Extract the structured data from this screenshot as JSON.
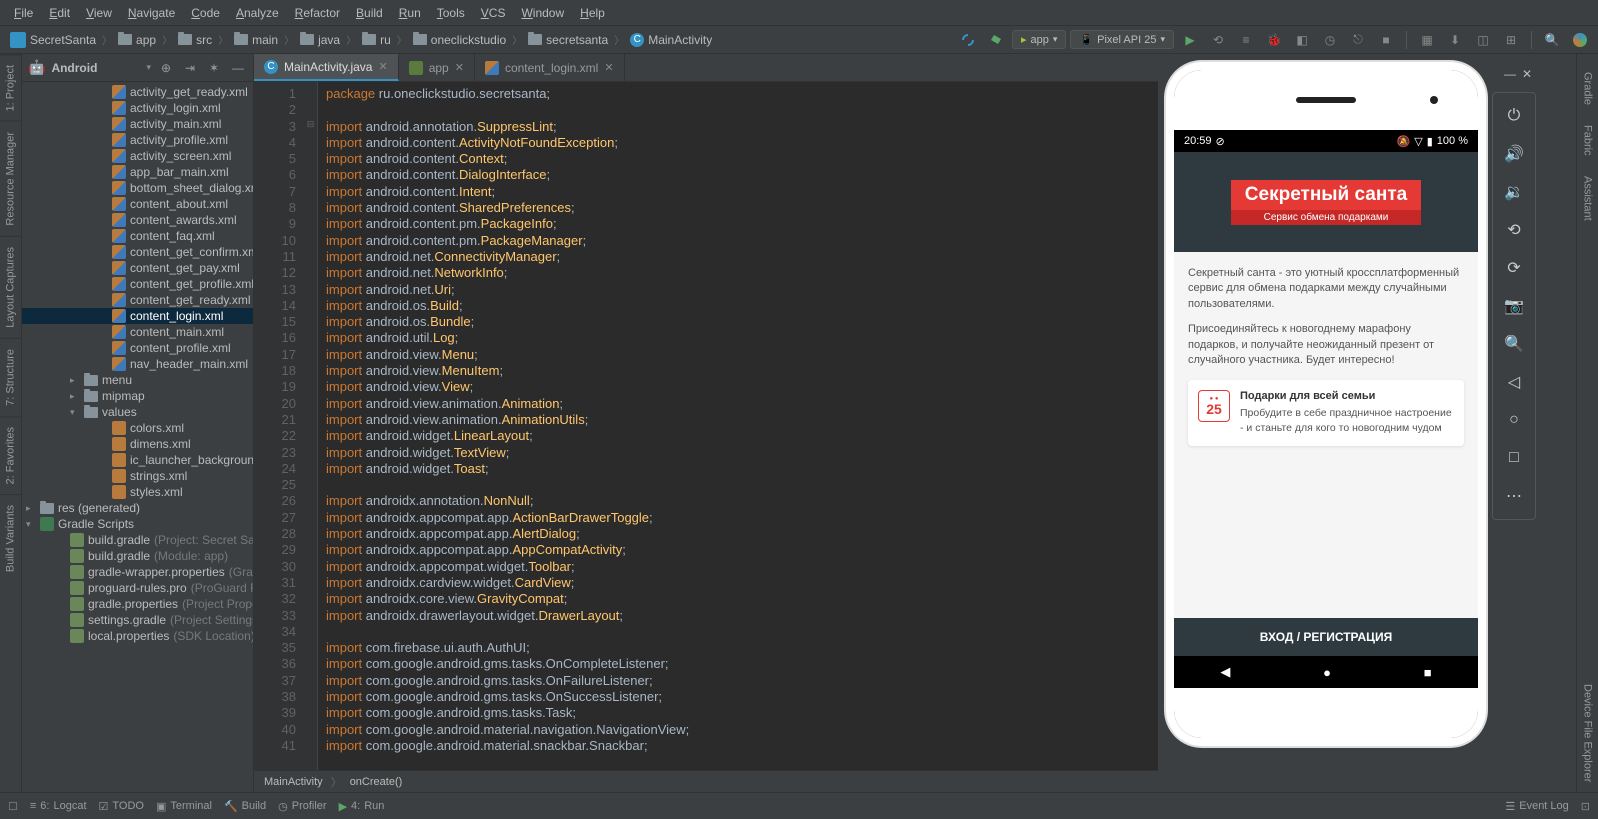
{
  "menubar": [
    "File",
    "Edit",
    "View",
    "Navigate",
    "Code",
    "Analyze",
    "Refactor",
    "Build",
    "Run",
    "Tools",
    "VCS",
    "Window",
    "Help"
  ],
  "breadcrumb": {
    "project": "SecretSanta",
    "items": [
      "app",
      "src",
      "main",
      "java",
      "ru",
      "oneclickstudio",
      "secretsanta"
    ],
    "activity": "MainActivity"
  },
  "runConfig": {
    "app": "app",
    "device": "Pixel API 25"
  },
  "projectPanel": {
    "title": "Android"
  },
  "tree": {
    "layouts": [
      "activity_get_ready.xml",
      "activity_login.xml",
      "activity_main.xml",
      "activity_profile.xml",
      "activity_screen.xml",
      "app_bar_main.xml",
      "bottom_sheet_dialog.xml",
      "content_about.xml",
      "content_awards.xml",
      "content_faq.xml",
      "content_get_confirm.xml",
      "content_get_pay.xml",
      "content_get_profile.xml",
      "content_get_ready.xml",
      "content_login.xml",
      "content_main.xml",
      "content_profile.xml",
      "nav_header_main.xml"
    ],
    "folders": {
      "menu": "menu",
      "mipmap": "mipmap",
      "values": "values",
      "res": "res (generated)",
      "gradle": "Gradle Scripts"
    },
    "values": [
      "colors.xml",
      "dimens.xml",
      "ic_launcher_background.xml",
      "strings.xml",
      "styles.xml"
    ],
    "gradle": [
      {
        "name": "build.gradle",
        "hint": "(Project: Secret Santa)"
      },
      {
        "name": "build.gradle",
        "hint": "(Module: app)"
      },
      {
        "name": "gradle-wrapper.properties",
        "hint": "(Gradle V"
      },
      {
        "name": "proguard-rules.pro",
        "hint": "(ProGuard Rules"
      },
      {
        "name": "gradle.properties",
        "hint": "(Project Properties"
      },
      {
        "name": "settings.gradle",
        "hint": "(Project Settings)"
      },
      {
        "name": "local.properties",
        "hint": "(SDK Location)"
      }
    ]
  },
  "tabs": [
    {
      "icon": "c",
      "label": "MainActivity.java",
      "active": true
    },
    {
      "icon": "mod",
      "label": "app",
      "active": false
    },
    {
      "icon": "xml",
      "label": "content_login.xml",
      "active": false
    }
  ],
  "code": {
    "pkg": "package ru.oneclickstudio.secretsanta;",
    "imports": [
      [
        "android.annotation.",
        "SuppressLint"
      ],
      [
        "android.content.",
        "ActivityNotFoundException"
      ],
      [
        "android.content.",
        "Context"
      ],
      [
        "android.content.",
        "DialogInterface"
      ],
      [
        "android.content.",
        "Intent"
      ],
      [
        "android.content.",
        "SharedPreferences"
      ],
      [
        "android.content.pm.",
        "PackageInfo"
      ],
      [
        "android.content.pm.",
        "PackageManager"
      ],
      [
        "android.net.",
        "ConnectivityManager"
      ],
      [
        "android.net.",
        "NetworkInfo"
      ],
      [
        "android.net.",
        "Uri"
      ],
      [
        "android.os.",
        "Build"
      ],
      [
        "android.os.",
        "Bundle"
      ],
      [
        "android.util.",
        "Log"
      ],
      [
        "android.view.",
        "Menu"
      ],
      [
        "android.view.",
        "MenuItem"
      ],
      [
        "android.view.",
        "View"
      ],
      [
        "android.view.animation.",
        "Animation"
      ],
      [
        "android.view.animation.",
        "AnimationUtils"
      ],
      [
        "android.widget.",
        "LinearLayout"
      ],
      [
        "android.widget.",
        "TextView"
      ],
      [
        "android.widget.",
        "Toast"
      ]
    ],
    "androidx": [
      [
        "androidx.annotation.",
        "NonNull"
      ],
      [
        "androidx.appcompat.app.",
        "ActionBarDrawerToggle"
      ],
      [
        "androidx.appcompat.app.",
        "AlertDialog"
      ],
      [
        "androidx.appcompat.app.",
        "AppCompatActivity"
      ],
      [
        "androidx.appcompat.widget.",
        "Toolbar"
      ],
      [
        "androidx.cardview.widget.",
        "CardView"
      ],
      [
        "androidx.core.view.",
        "GravityCompat"
      ],
      [
        "androidx.drawerlayout.widget.",
        "DrawerLayout"
      ]
    ],
    "google": [
      "com.firebase.ui.auth.AuthUI",
      "com.google.android.gms.tasks.OnCompleteListener",
      "com.google.android.gms.tasks.OnFailureListener",
      "com.google.android.gms.tasks.OnSuccessListener",
      "com.google.android.gms.tasks.Task",
      "com.google.android.material.navigation.NavigationView",
      "com.google.android.material.snackbar.Snackbar"
    ]
  },
  "editorFooter": {
    "class": "MainActivity",
    "method": "onCreate()"
  },
  "emulator": {
    "status": {
      "time": "20:59",
      "battery": "100 %"
    },
    "app": {
      "title": "Секретный санта",
      "subtitle": "Сервис обмена подарками",
      "p1": "Секретный санта - это уютный кроссплатформенный сервис для обмена подарками между случайными пользователями.",
      "p2": "Присоединяйтесь к новогоднему марафону подарков, и получайте неожиданный презент от случайного участника. Будет интересно!",
      "card": {
        "day": "25",
        "title": "Подарки для всей семьи",
        "text": "Пробудите в себе праздничное настроение - и станьте для кого то новогодним чудом"
      },
      "login": "ВХОД / РЕГИСТРАЦИЯ"
    }
  },
  "bottom": {
    "items": [
      "Logcat",
      "TODO",
      "Terminal",
      "Build",
      "Profiler",
      "Run"
    ],
    "prefixes": [
      "6:",
      "",
      "",
      "",
      "",
      "4:"
    ],
    "eventLog": "Event Log"
  },
  "leftTools": [
    "1: Project",
    "Resource Manager",
    "Layout Captures",
    "7: Structure",
    "2: Favorites",
    "Build Variants"
  ],
  "rightTools": [
    "Gradle",
    "Fabric",
    "Assistant",
    "Device File Explorer"
  ]
}
